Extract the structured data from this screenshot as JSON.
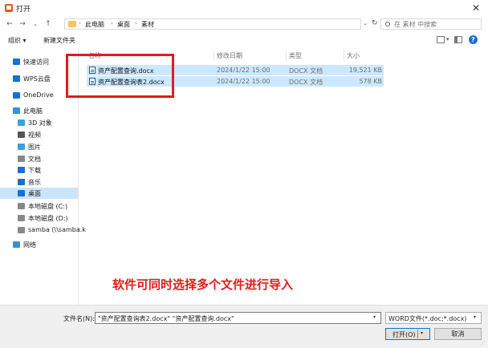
{
  "window": {
    "title": "打开",
    "close_glyph": "✕"
  },
  "nav": {
    "back": "←",
    "forward": "→",
    "dropdown": "⌄",
    "up": "↑",
    "breadcrumb": [
      "此电脑",
      "桌面",
      "素材"
    ],
    "crumb_sep": "›",
    "addr_dropdown": "⌄",
    "refresh": "↻",
    "search_placeholder": "在 素材 中搜索"
  },
  "toolbar": {
    "organize": "组织 ▾",
    "new_folder": "新建文件夹",
    "view_dropdown": "▾",
    "help": "?"
  },
  "sidebar": {
    "items": [
      {
        "label": "快速访问",
        "icon": "star-icon",
        "color": "#1a6fd0"
      },
      {
        "label": "WPS云盘",
        "icon": "cloud-icon",
        "color": "#1a6fd0"
      },
      {
        "label": "OneDrive",
        "icon": "onedrive-icon",
        "color": "#1a6fd0"
      },
      {
        "label": "此电脑",
        "icon": "computer-icon",
        "color": "#3a8fd8"
      },
      {
        "label": "3D 对象",
        "icon": "cube-icon",
        "color": "#3aa0e0"
      },
      {
        "label": "视频",
        "icon": "video-icon",
        "color": "#555555"
      },
      {
        "label": "图片",
        "icon": "picture-icon",
        "color": "#3aa0e0"
      },
      {
        "label": "文档",
        "icon": "document-icon",
        "color": "#888888"
      },
      {
        "label": "下载",
        "icon": "download-icon",
        "color": "#1a6fd0"
      },
      {
        "label": "音乐",
        "icon": "music-icon",
        "color": "#1a6fd0"
      },
      {
        "label": "桌面",
        "icon": "desktop-icon",
        "color": "#1a6fd0"
      },
      {
        "label": "本地磁盘 (C:)",
        "icon": "drive-icon",
        "color": "#888888"
      },
      {
        "label": "本地磁盘 (D:)",
        "icon": "drive-icon",
        "color": "#888888"
      },
      {
        "label": "samba (\\\\samba.k",
        "icon": "network-drive-icon",
        "color": "#888888"
      },
      {
        "label": "网络",
        "icon": "network-icon",
        "color": "#3a8fd8"
      }
    ],
    "selected": "桌面"
  },
  "columns": {
    "name": "名称",
    "date": "修改日期",
    "type": "类型",
    "size": "大小"
  },
  "files": [
    {
      "name": "资产配置查询.docx",
      "date": "2024/1/22 15:00",
      "type": "DOCX 文档",
      "size": "19,521 KB"
    },
    {
      "name": "资产配置查询表2.docx",
      "date": "2024/1/22 15:00",
      "type": "DOCX 文档",
      "size": "578 KB"
    }
  ],
  "annotation": "软件可同时选择多个文件进行导入",
  "bottom": {
    "filename_label": "文件名(N):",
    "filename_value": "\"资产配置查询表2.docx\" \"资产配置查询.docx\"",
    "dropdown": "▾",
    "filetype_value": "WORD文件(*.doc;*.docx)",
    "open_label": "打开(O)",
    "cancel_label": "取消",
    "grip": "⋰"
  },
  "colors": {
    "selection": "#cce8ff",
    "annotation_red": "#e31b1b",
    "accent": "#0078d7"
  }
}
